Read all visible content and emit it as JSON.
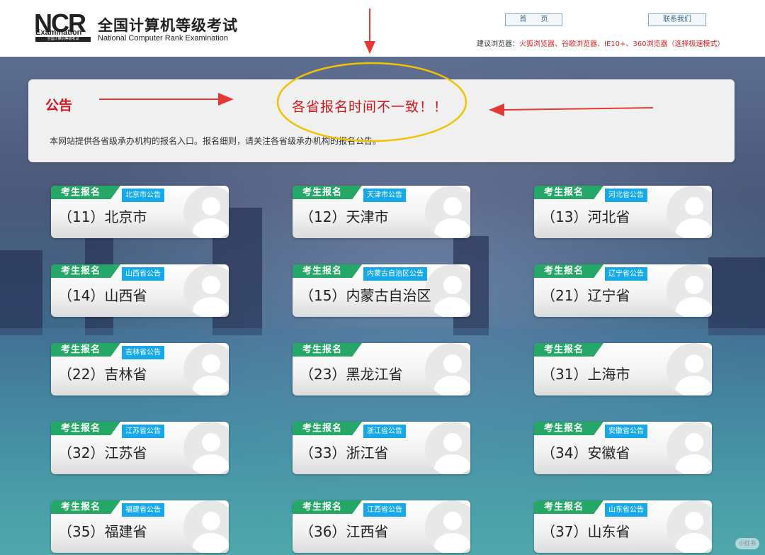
{
  "header": {
    "logo_letters": "NCR",
    "logo_word": "Examination",
    "logo_sub": "全国计算机等级考试",
    "title": "全国计算机等级考试",
    "subtitle": "National Computer Rank Examination",
    "nav": {
      "home": "首　　页",
      "contact": "联系我们"
    },
    "browser_tip": {
      "label": "建议浏览器：",
      "browsers": "火狐浏览器、谷歌浏览器、IE10+、360浏览器（选择极速模式）"
    }
  },
  "notice": {
    "title": "公告",
    "headline": "各省报名时间不一致！！",
    "body": "本网站提供各省级承办机构的报名入口。报名细则，请关注各省级承办机构的报名公告。"
  },
  "cards": [
    {
      "tag": "考生报名",
      "link": "北京市公告",
      "name": "（11）北京市"
    },
    {
      "tag": "考生报名",
      "link": "天津市公告",
      "name": "（12）天津市"
    },
    {
      "tag": "考生报名",
      "link": "河北省公告",
      "name": "（13）河北省"
    },
    {
      "tag": "考生报名",
      "link": "山西省公告",
      "name": "（14）山西省"
    },
    {
      "tag": "考生报名",
      "link": "内蒙古自治区公告",
      "name": "（15）内蒙古自治区"
    },
    {
      "tag": "考生报名",
      "link": "辽宁省公告",
      "name": "（21）辽宁省"
    },
    {
      "tag": "考生报名",
      "link": "吉林省公告",
      "name": "（22）吉林省"
    },
    {
      "tag": "考生报名",
      "link": "",
      "name": "（23）黑龙江省"
    },
    {
      "tag": "考生报名",
      "link": "",
      "name": "（31）上海市"
    },
    {
      "tag": "考生报名",
      "link": "江苏省公告",
      "name": "（32）江苏省"
    },
    {
      "tag": "考生报名",
      "link": "浙江省公告",
      "name": "（33）浙江省"
    },
    {
      "tag": "考生报名",
      "link": "安徽省公告",
      "name": "（34）安徽省"
    },
    {
      "tag": "考生报名",
      "link": "福建省公告",
      "name": "（35）福建省"
    },
    {
      "tag": "考生报名",
      "link": "江西省公告",
      "name": "（36）江西省"
    },
    {
      "tag": "考生报名",
      "link": "山东省公告",
      "name": "（37）山东省"
    }
  ],
  "watermark": "小红书",
  "colors": {
    "accent_red": "#d4161c",
    "tag_green": "#25a768",
    "link_blue": "#16a8e8",
    "annotation_red": "#e53935",
    "annotation_yellow": "#f2c200"
  }
}
